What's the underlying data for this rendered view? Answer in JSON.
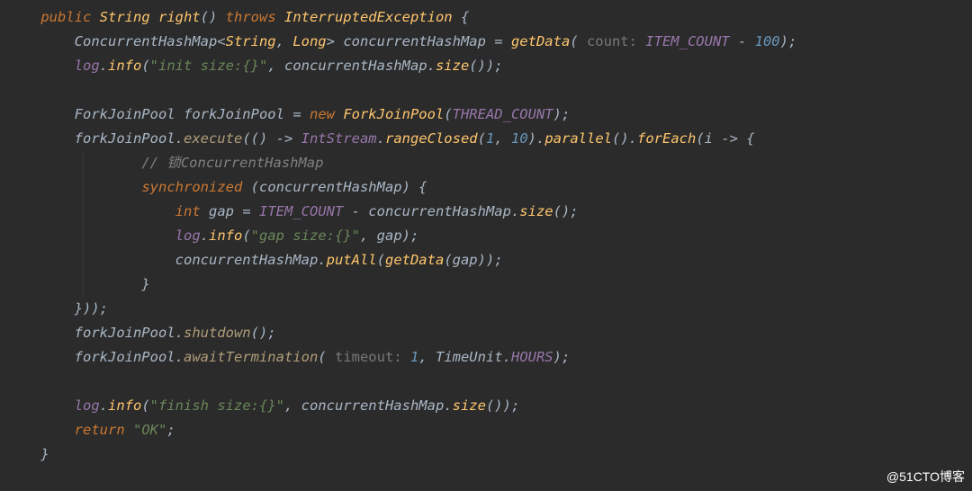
{
  "code": {
    "lines": [
      {
        "indent": 1,
        "tokens": [
          {
            "t": "public ",
            "c": "kw"
          },
          {
            "t": "String ",
            "c": "type"
          },
          {
            "t": "right",
            "c": "method"
          },
          {
            "t": "() ",
            "c": "punct"
          },
          {
            "t": "throws ",
            "c": "kw"
          },
          {
            "t": "InterruptedException ",
            "c": "type"
          },
          {
            "t": "{",
            "c": "punct"
          }
        ]
      },
      {
        "indent": 2,
        "tokens": [
          {
            "t": "ConcurrentHashMap",
            "c": "plain"
          },
          {
            "t": "<",
            "c": "punct"
          },
          {
            "t": "String",
            "c": "type"
          },
          {
            "t": ", ",
            "c": "punct"
          },
          {
            "t": "Long",
            "c": "type"
          },
          {
            "t": "> ",
            "c": "punct"
          },
          {
            "t": "concurrentHashMap ",
            "c": "ident"
          },
          {
            "t": "= ",
            "c": "op"
          },
          {
            "t": "getData",
            "c": "method"
          },
          {
            "t": "( ",
            "c": "punct"
          },
          {
            "t": "count: ",
            "c": "hint"
          },
          {
            "t": "ITEM_COUNT ",
            "c": "const"
          },
          {
            "t": "- ",
            "c": "op"
          },
          {
            "t": "100",
            "c": "num"
          },
          {
            "t": ");",
            "c": "punct"
          }
        ]
      },
      {
        "indent": 2,
        "tokens": [
          {
            "t": "log",
            "c": "static"
          },
          {
            "t": ".",
            "c": "punct"
          },
          {
            "t": "info",
            "c": "method"
          },
          {
            "t": "(",
            "c": "punct"
          },
          {
            "t": "\"init size:{}\"",
            "c": "str"
          },
          {
            "t": ", concurrentHashMap.",
            "c": "plain"
          },
          {
            "t": "size",
            "c": "method"
          },
          {
            "t": "());",
            "c": "punct"
          }
        ]
      },
      {
        "indent": 2,
        "tokens": []
      },
      {
        "indent": 2,
        "tokens": [
          {
            "t": "ForkJoinPool ",
            "c": "plain"
          },
          {
            "t": "forkJoinPool ",
            "c": "ident"
          },
          {
            "t": "= ",
            "c": "op"
          },
          {
            "t": "new ",
            "c": "kw"
          },
          {
            "t": "ForkJoinPool",
            "c": "method"
          },
          {
            "t": "(",
            "c": "punct"
          },
          {
            "t": "THREAD_COUNT",
            "c": "const"
          },
          {
            "t": ");",
            "c": "punct"
          }
        ]
      },
      {
        "indent": 2,
        "tokens": [
          {
            "t": "forkJoinPool.",
            "c": "plain"
          },
          {
            "t": "execute",
            "c": "fn"
          },
          {
            "t": "(() -> ",
            "c": "punct"
          },
          {
            "t": "IntStream",
            "c": "static"
          },
          {
            "t": ".",
            "c": "punct"
          },
          {
            "t": "rangeClosed",
            "c": "method"
          },
          {
            "t": "(",
            "c": "punct"
          },
          {
            "t": "1",
            "c": "num"
          },
          {
            "t": ", ",
            "c": "punct"
          },
          {
            "t": "10",
            "c": "num"
          },
          {
            "t": ").",
            "c": "punct"
          },
          {
            "t": "parallel",
            "c": "method"
          },
          {
            "t": "().",
            "c": "punct"
          },
          {
            "t": "forEach",
            "c": "method"
          },
          {
            "t": "(i -> {",
            "c": "punct"
          }
        ]
      },
      {
        "indent": 3,
        "guide": true,
        "tokens": [
          {
            "t": "// 锁ConcurrentHashMap",
            "c": "comment"
          }
        ]
      },
      {
        "indent": 3,
        "guide": true,
        "tokens": [
          {
            "t": "synchronized ",
            "c": "kw"
          },
          {
            "t": "(concurrentHashMap) {",
            "c": "punct"
          }
        ]
      },
      {
        "indent": 4,
        "guide": true,
        "tokens": [
          {
            "t": "int ",
            "c": "kw"
          },
          {
            "t": "gap ",
            "c": "ident"
          },
          {
            "t": "= ",
            "c": "op"
          },
          {
            "t": "ITEM_COUNT ",
            "c": "const"
          },
          {
            "t": "- concurrentHashMap.",
            "c": "plain"
          },
          {
            "t": "size",
            "c": "method"
          },
          {
            "t": "();",
            "c": "punct"
          }
        ]
      },
      {
        "indent": 4,
        "guide": true,
        "tokens": [
          {
            "t": "log",
            "c": "static"
          },
          {
            "t": ".",
            "c": "punct"
          },
          {
            "t": "info",
            "c": "method"
          },
          {
            "t": "(",
            "c": "punct"
          },
          {
            "t": "\"gap size:{}\"",
            "c": "str"
          },
          {
            "t": ", gap);",
            "c": "punct"
          }
        ]
      },
      {
        "indent": 4,
        "guide": true,
        "tokens": [
          {
            "t": "concurrentHashMap.",
            "c": "plain"
          },
          {
            "t": "putAll",
            "c": "method"
          },
          {
            "t": "(",
            "c": "punct"
          },
          {
            "t": "getData",
            "c": "method"
          },
          {
            "t": "(gap));",
            "c": "punct"
          }
        ]
      },
      {
        "indent": 3,
        "guide": true,
        "tokens": [
          {
            "t": "}",
            "c": "punct"
          }
        ]
      },
      {
        "indent": 2,
        "tokens": [
          {
            "t": "}));",
            "c": "punct"
          }
        ]
      },
      {
        "indent": 2,
        "tokens": [
          {
            "t": "forkJoinPool.",
            "c": "plain"
          },
          {
            "t": "shutdown",
            "c": "fn"
          },
          {
            "t": "();",
            "c": "punct"
          }
        ]
      },
      {
        "indent": 2,
        "tokens": [
          {
            "t": "forkJoinPool.",
            "c": "plain"
          },
          {
            "t": "awaitTermination",
            "c": "fn"
          },
          {
            "t": "( ",
            "c": "punct"
          },
          {
            "t": "timeout: ",
            "c": "hint"
          },
          {
            "t": "1",
            "c": "num"
          },
          {
            "t": ", ",
            "c": "punct"
          },
          {
            "t": "TimeUnit",
            "c": "plain"
          },
          {
            "t": ".",
            "c": "punct"
          },
          {
            "t": "HOURS",
            "c": "const"
          },
          {
            "t": ");",
            "c": "punct"
          }
        ]
      },
      {
        "indent": 2,
        "tokens": []
      },
      {
        "indent": 2,
        "tokens": [
          {
            "t": "log",
            "c": "static"
          },
          {
            "t": ".",
            "c": "punct"
          },
          {
            "t": "info",
            "c": "method"
          },
          {
            "t": "(",
            "c": "punct"
          },
          {
            "t": "\"finish size:{}\"",
            "c": "str"
          },
          {
            "t": ", concurrentHashMap.",
            "c": "plain"
          },
          {
            "t": "size",
            "c": "method"
          },
          {
            "t": "());",
            "c": "punct"
          }
        ]
      },
      {
        "indent": 2,
        "tokens": [
          {
            "t": "return ",
            "c": "kw"
          },
          {
            "t": "\"OK\"",
            "c": "str"
          },
          {
            "t": ";",
            "c": "punct"
          }
        ]
      },
      {
        "indent": 1,
        "tokens": [
          {
            "t": "}",
            "c": "punct"
          }
        ]
      }
    ]
  },
  "watermark": "@51CTO博客"
}
